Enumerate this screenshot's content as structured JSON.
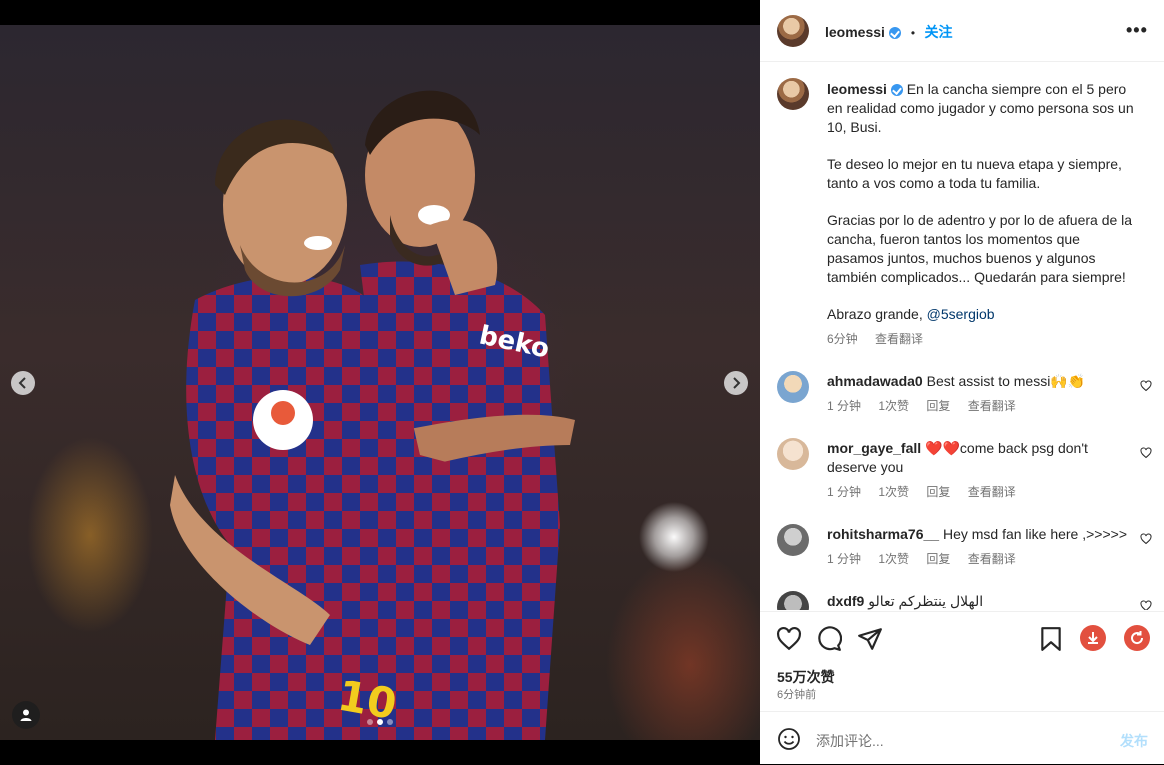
{
  "post": {
    "username": "leomessi",
    "follow_label": "关注",
    "dot": "•",
    "more_label": "•••",
    "caption_paragraphs": [
      "En la cancha siempre con el 5 pero en realidad como jugador y como persona sos un 10, Busi.",
      "Te deseo lo mejor en tu nueva etapa y siempre, tanto a vos como a toda tu familia.",
      "Gracias por lo de adentro y por lo de afuera de la cancha, fueron tantos los momentos que pasamos juntos, muchos buenos y algunos también complicados... Quedarán para siempre!"
    ],
    "caption_last": "Abrazo grande,",
    "caption_mention": "@5sergiob",
    "caption_time": "6分钟",
    "translate_label": "查看翻译",
    "likes": "55万次赞",
    "posted_ago": "6分钟前",
    "carousel": {
      "total": 3,
      "active": 2
    }
  },
  "comments": [
    {
      "username": "ahmadawada0",
      "text": "Best assist to messi🙌👏",
      "time": "1 分钟",
      "likes": "1次赞",
      "reply": "回复",
      "translate": "查看翻译"
    },
    {
      "username": "mor_gaye_fall",
      "text": "❤️❤️come back psg don't deserve you",
      "time": "1 分钟",
      "likes": "1次赞",
      "reply": "回复",
      "translate": "查看翻译"
    },
    {
      "username": "rohitsharma76__",
      "text": "Hey msd fan like here ,>>>>>",
      "time": "1 分钟",
      "likes": "1次赞",
      "reply": "回复",
      "translate": "查看翻译"
    },
    {
      "username": "dxdf9",
      "text": "الهلال ينتظركم تعالو"
    }
  ],
  "add_comment": {
    "placeholder": "添加评论...",
    "post_label": "发布"
  },
  "icons": {
    "like": "heart-icon",
    "comment": "comment-icon",
    "share": "send-icon",
    "save": "bookmark-icon",
    "download": "download-icon",
    "refresh": "refresh-icon",
    "emoji": "emoji-icon",
    "tag": "user-tag-icon"
  },
  "colors": {
    "accent": "#0095f6",
    "verified": "#3897f0",
    "download_red": "#e2503f",
    "refresh_red": "#e2503f"
  }
}
